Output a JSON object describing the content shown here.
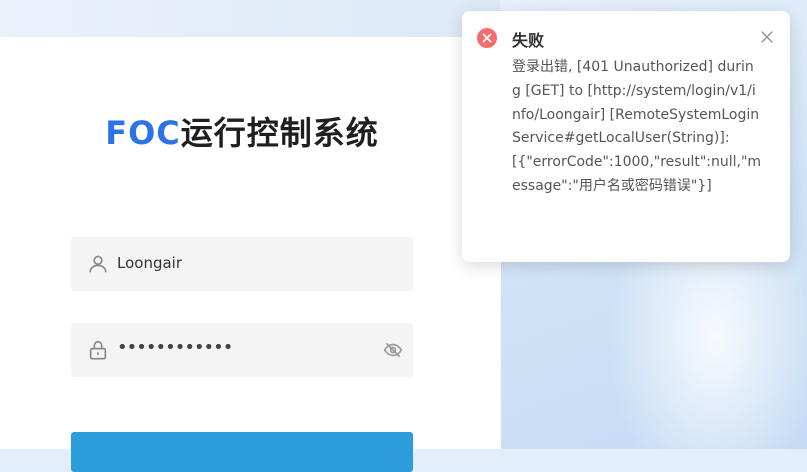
{
  "login": {
    "title_brand": "FOC",
    "title_rest": "运行控制系统",
    "username_value": "Loongair",
    "password_value": "••••••••••••"
  },
  "notification": {
    "title": "失败",
    "message": "登录出错, [401 Unauthorized] during [GET] to [http://system/login/v1/info/Loongair] [RemoteSystemLoginService#getLocalUser(String)]: [{\"errorCode\":1000,\"result\":null,\"message\":\"用户名或密码错误\"}]"
  },
  "colors": {
    "brand": "#2b73e6",
    "error": "#f56c6c",
    "button": "#2d9cdb"
  },
  "icons": {
    "user": "user-icon",
    "lock": "lock-icon",
    "eye_off": "eye-off-icon",
    "error": "error-circle-icon",
    "close": "close-icon"
  }
}
